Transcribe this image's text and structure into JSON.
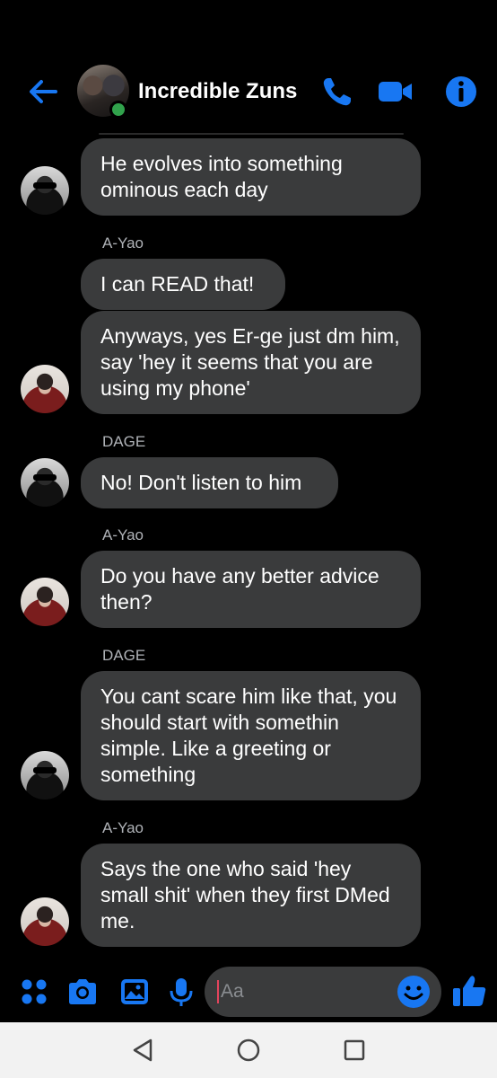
{
  "header": {
    "title": "Incredible Zuns",
    "back_icon": "arrow-left-icon",
    "call_icon": "phone-icon",
    "video_icon": "video-camera-icon",
    "info_icon": "info-icon",
    "accent": "#1877f2",
    "online_color": "#31a24c"
  },
  "messages": [
    {
      "sender": "",
      "text": "He evolves into something ominous each day",
      "avatar": "DAGE"
    },
    {
      "sender": "A-Yao",
      "text": "I can READ that!",
      "avatar": ""
    },
    {
      "sender": "",
      "text": "Anyways, yes Er-ge just dm him, say 'hey it seems that you are using my phone'",
      "avatar": "A-Yao"
    },
    {
      "sender": "DAGE",
      "text": "No! Don't listen to him",
      "avatar": "DAGE"
    },
    {
      "sender": "A-Yao",
      "text": "Do you have any better advice then?",
      "avatar": "A-Yao"
    },
    {
      "sender": "DAGE",
      "text": "You cant scare him like that, you should start with somethin simple. Like a greeting or something",
      "avatar": "DAGE"
    },
    {
      "sender": "A-Yao",
      "text": "Says the one who said 'hey small shit' when they first DMed me.",
      "avatar": "A-Yao"
    }
  ],
  "composer": {
    "placeholder": "Aa",
    "icons": [
      "apps-icon",
      "camera-icon",
      "gallery-icon",
      "microphone-icon",
      "emoji-icon",
      "thumbs-up-icon"
    ]
  },
  "navbar": {
    "icons": [
      "back-triangle-icon",
      "home-circle-icon",
      "recents-square-icon"
    ]
  },
  "colors": {
    "background": "#000000",
    "bubble": "#3a3b3c",
    "sender_label": "#b0b3b8",
    "caret": "#e4445d"
  }
}
